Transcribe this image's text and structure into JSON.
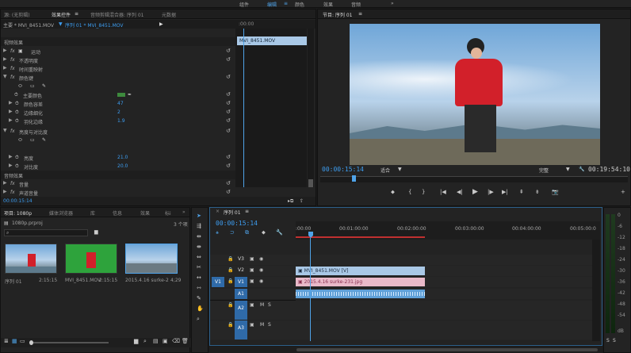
{
  "workspaces": [
    "组件",
    "编辑",
    "颜色",
    "效果",
    "音频"
  ],
  "workspace_more": "»",
  "effect_panel": {
    "tabs": [
      "源: (无剪辑)",
      "效果控件",
      "音频剪辑混合器: 序列 01",
      "元数据"
    ],
    "tab_menu": "≡",
    "clip_master": "主要 * MVI_8451.MOV",
    "clip_seq": "序列 01 * MVI_8451.MOV",
    "mini_ruler": ":00:00",
    "mini_clip": "MVI_8451.MOV",
    "video_effects_header": "视频效果",
    "effects": [
      {
        "label": "运动",
        "indent": 1
      },
      {
        "label": "不透明度",
        "indent": 1
      },
      {
        "label": "时间重映射",
        "indent": 1
      },
      {
        "label": "颜色键",
        "indent": 1
      }
    ],
    "keycolor_label": "主要颜色",
    "color_props": [
      {
        "label": "颜色容差",
        "value": "47"
      },
      {
        "label": "边缘细化",
        "value": "2"
      },
      {
        "label": "羽化边缘",
        "value": "1.9"
      }
    ],
    "bright_effect": "亮度与对比度",
    "bright_props": [
      {
        "label": "亮度",
        "value": "21.0"
      },
      {
        "label": "对比度",
        "value": "20.0"
      }
    ],
    "audio_effects_header": "音频效果",
    "audio_props": [
      "音量",
      "声道音量"
    ],
    "timecode": "00:00:15:14"
  },
  "program": {
    "title": "节目: 序列 01",
    "menu": "≡",
    "timecode": "00:00:15:14",
    "fit": "适合",
    "quality": "完整",
    "duration": "00:19:54:10"
  },
  "project": {
    "tabs": [
      "项目: 1080p",
      "媒体浏览器",
      "库",
      "信息",
      "效果",
      "标i"
    ],
    "more": "»",
    "file": "1080p.prproj",
    "count": "3 个项",
    "items": [
      {
        "name": "序列 01",
        "duration": "2:15:15"
      },
      {
        "name": "MVI_8451.MOV",
        "duration": "2:15:15"
      },
      {
        "name": "2015.4.16 surke-2...",
        "duration": "4;29"
      }
    ]
  },
  "timeline": {
    "close": "×",
    "title": "序列 01",
    "menu": "≡",
    "timecode": "00:00:15:14",
    "ruler": [
      ":00:00",
      "00:01:00:00",
      "00:02:00:00",
      "00:03:00:00",
      "00:04:00:00",
      "00:05:00:0"
    ],
    "video_tracks": [
      "V3",
      "V2",
      "V1"
    ],
    "audio_tracks": [
      "A1",
      "A2",
      "A3"
    ],
    "source_v": "V1",
    "source_a": "A1",
    "clip_v": "MVI_8451.MOV [V]",
    "clip_img": "2015.4.16 surke-231.jpg",
    "m": "M",
    "s": "S"
  },
  "meter": {
    "labels": [
      "0",
      "-6",
      "-12",
      "-18",
      "-24",
      "-30",
      "-36",
      "-42",
      "-48",
      "-54",
      "dB"
    ],
    "solo": "S"
  },
  "colors": {
    "accent": "#3d9df0",
    "clip_video": "#a9c8e6",
    "clip_image": "#e9b9c9",
    "playhead": "#4fa3e8",
    "panel": "#232323"
  }
}
